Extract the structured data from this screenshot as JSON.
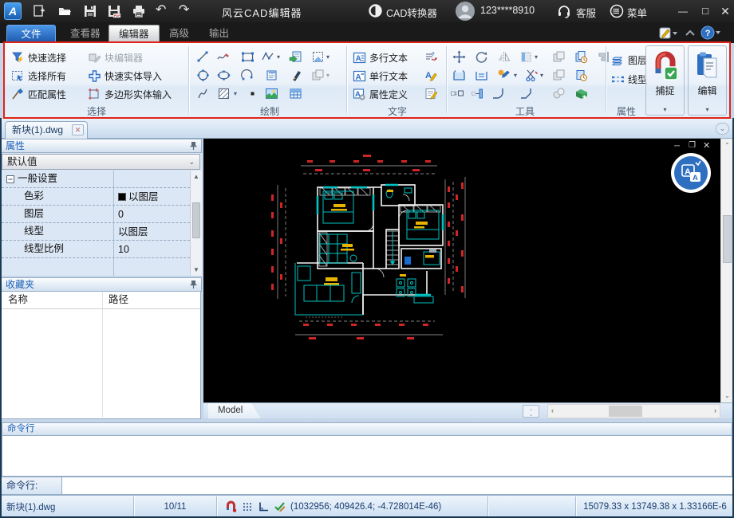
{
  "titlebar": {
    "title": "风云CAD编辑器",
    "converter_label": "CAD转换器",
    "account": "123****8910",
    "support_label": "客服",
    "menu_label": "菜单"
  },
  "menu_tabs": {
    "file": "文件",
    "viewer": "查看器",
    "editor": "编辑器",
    "advanced": "高级",
    "output": "输出"
  },
  "ribbon": {
    "select": {
      "label": "选择",
      "quick_select": "快速选择",
      "select_all": "选择所有",
      "match_properties": "匹配属性",
      "block_editor": "块编辑器",
      "quick_entity_import": "快速实体导入",
      "polygon_entity_input": "多边形实体输入"
    },
    "draw": {
      "label": "绘制"
    },
    "text": {
      "label": "文字",
      "mtext": "多行文本",
      "dtext": "单行文本",
      "attdef": "属性定义"
    },
    "tools": {
      "label": "工具"
    },
    "props": {
      "label": "属性",
      "layers": "图层",
      "linetype": "线型"
    },
    "snap_label": "捕捉",
    "edit_label": "编辑"
  },
  "document_tab": {
    "name": "新块(1).dwg"
  },
  "properties_panel": {
    "title": "属性",
    "preset": "默认值",
    "section": "一般设置",
    "rows": [
      {
        "label": "色彩",
        "value": "以图层"
      },
      {
        "label": "图层",
        "value": "0"
      },
      {
        "label": "线型",
        "value": "以图层"
      },
      {
        "label": "线型比例",
        "value": "10"
      }
    ]
  },
  "favorites_panel": {
    "title": "收藏夹",
    "col_name": "名称",
    "col_path": "路径"
  },
  "canvas": {
    "model_tab_label": "Model"
  },
  "command_panel": {
    "title": "命令行",
    "prompt_label": "命令行:",
    "input_value": ""
  },
  "statusbar": {
    "file_name": "新块(1).dwg",
    "sheet": "10/11",
    "coordinates": "(1032956; 409426.4; -4.728014E-46)",
    "extents": "15079.33 x 13749.38 x 1.33166E-6"
  },
  "colors": {
    "accent_blue": "#2f6fc2",
    "ribbon_border_red": "#e02318",
    "canvas_black": "#000000",
    "status_text": "#1b3c6e"
  }
}
